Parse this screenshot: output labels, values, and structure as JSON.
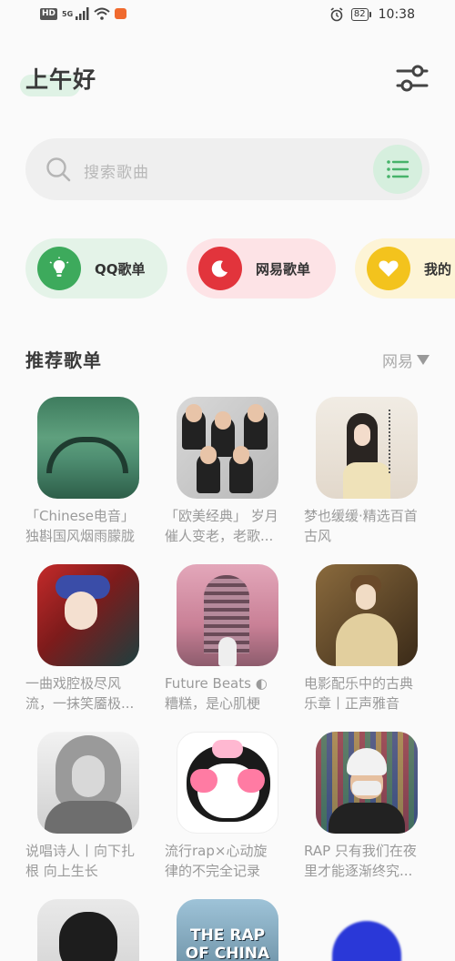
{
  "status_bar": {
    "hd": "HD",
    "network": "5G",
    "battery": "82",
    "time": "10:38"
  },
  "header": {
    "greeting": "上午好"
  },
  "search": {
    "placeholder": "搜索歌曲"
  },
  "platforms": [
    {
      "label": "QQ歌单",
      "color": "#3daa5c"
    },
    {
      "label": "网易歌单",
      "color": "#e2343c"
    },
    {
      "label": "我的",
      "color": "#f3c31d"
    }
  ],
  "section": {
    "title": "推荐歌单",
    "source": "网易"
  },
  "playlists": [
    {
      "title": "「Chinese电音」独斟国风烟雨朦胧"
    },
    {
      "title": "「欧美经典」 岁月催人变老，老歌..."
    },
    {
      "title": "梦也缓缓·精选百首古风"
    },
    {
      "title": "一曲戏腔极尽风流，一抹笑靥极..."
    },
    {
      "title": "Future Beats ◐ 糟糕，是心肌梗塞..."
    },
    {
      "title": "电影配乐中的古典乐章丨正声雅音"
    },
    {
      "title": "说唱诗人丨向下扎根 向上生长"
    },
    {
      "title": "流行rap×心动旋律的不完全记录"
    },
    {
      "title": "RAP 只有我们在夜里才能逐渐终究..."
    },
    {
      "title": ""
    },
    {
      "title": "",
      "cover_text": "THE RAP OF CHINA"
    },
    {
      "title": ""
    }
  ]
}
